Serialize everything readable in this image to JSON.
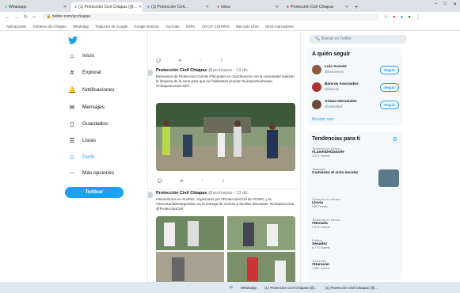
{
  "browser": {
    "tabs": [
      {
        "label": "Whatsapp"
      },
      {
        "label": "(1) Protección Civil Chiapas (@..."
      },
      {
        "label": "(1) Protección Civil..."
      },
      {
        "label": "Inbox"
      },
      {
        "label": "Protección Civil Chiapas"
      }
    ],
    "url": "twitter.com/pcchiapas",
    "bookmarks": [
      "Aplicaciones",
      "Gobierno de Chiapas",
      "Whatsapp",
      "Traductor de Google",
      "Google Noticias",
      "YouTube",
      "SSPC",
      "CECyT CHIAPAS",
      "Mercado Libre",
      "Otros marcadores"
    ]
  },
  "nav": {
    "items": [
      {
        "label": "Inicio",
        "icon": "home-icon"
      },
      {
        "label": "Explorar",
        "icon": "hashtag-icon"
      },
      {
        "label": "Notificaciones",
        "icon": "bell-icon"
      },
      {
        "label": "Mensajes",
        "icon": "mail-icon"
      },
      {
        "label": "Guardados",
        "icon": "bookmark-icon"
      },
      {
        "label": "Listas",
        "icon": "list-icon"
      },
      {
        "label": "Perfil",
        "icon": "user-icon"
      },
      {
        "label": "Más opciones",
        "icon": "more-icon"
      }
    ],
    "tweet_button": "Twittear"
  },
  "feed": {
    "tweets": [
      {
        "name": "Protección Civil Chiapas",
        "handle": "@pcchiapas",
        "time": "13 dic.",
        "text": "Elementos de Protección Civil de #Tecpatán en coordinación con la comunidad realizan la limpieza de la zona para que los habitantes puedan #LimpiarSusCasas. #ChiapasActúaCNPC"
      },
      {
        "name": "Protección Civil Chiapas",
        "handle": "@pcchiapas",
        "time": "13 dic.",
        "text": "Intervenimos en #LaPaz, organizado por #ProtecciónCivil de #CNPC y la #SecretaríaDeSeguridad, en la entrega de víveres a familias afectadas. #ChiapasActúa @ProtecciónCivil"
      }
    ]
  },
  "sidebar": {
    "search_placeholder": "Buscar en Twitter",
    "who_to_follow_title": "A quién seguir",
    "who_to_follow": [
      {
        "name": "Luis Aceves",
        "handle": "@luisaceves",
        "button": "Seguir"
      },
      {
        "name": "Bancos Asociados",
        "handle": "@bancos",
        "button": "Seguir"
      },
      {
        "name": "Ariana Hernández",
        "handle": "@arianahdz",
        "button": "Seguir"
      }
    ],
    "show_more": "Mostrar más",
    "trends_title": "Tendencias para ti",
    "trends": [
      {
        "category": "Tendencia en México",
        "name": "#LunesDeGanarle",
        "count": "3.579 Tweets"
      },
      {
        "category": "Tendencia",
        "name": "Comienza el ciclo escolar",
        "count": ""
      },
      {
        "category": "Tendencia en México",
        "name": "Lluvia",
        "count": "30K Tweets"
      },
      {
        "category": "Tendencia en México",
        "name": "#Nevada",
        "count": "4.378 Tweets"
      },
      {
        "category": "Política",
        "name": "Senador",
        "count": "8.770 Tweets"
      },
      {
        "category": "Tendencia",
        "name": "#Huracán",
        "count": "1.584 Tweets"
      }
    ]
  },
  "taskbar": {
    "items": [
      "Whatsapp",
      "(1) Protección Civil Chiapas (@...",
      "(1) Protección Civil Chiapas (@..."
    ]
  },
  "colors": {
    "accent": "#1da1f2",
    "panel": "#f5f8fa"
  }
}
